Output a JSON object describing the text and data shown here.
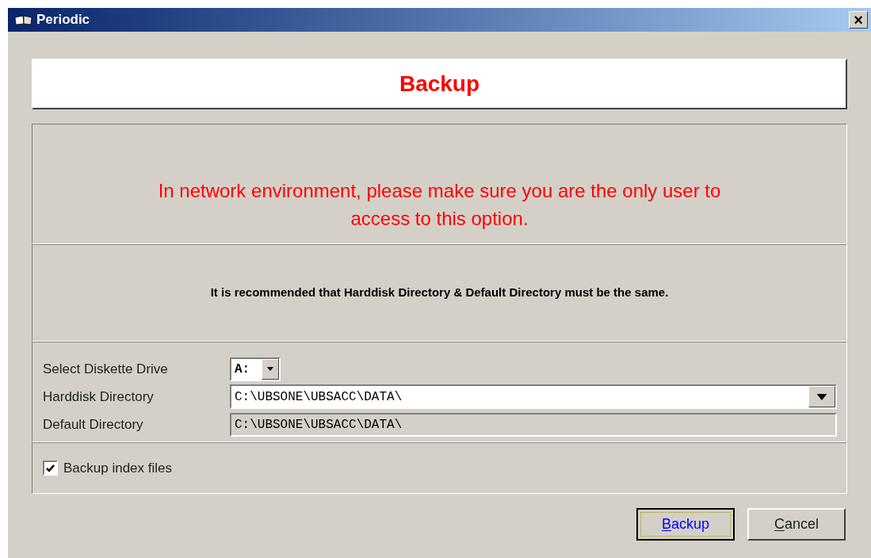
{
  "window": {
    "title": "Periodic",
    "close": "×"
  },
  "heading": "Backup",
  "warning": "In network environment, please make sure you are the only user to access to this option.",
  "note": "It is recommended that Harddisk Directory & Default Directory must be the same.",
  "fields": [
    {
      "kind": "drive",
      "label": "Select Diskette Drive",
      "value": "A:"
    },
    {
      "kind": "combo",
      "label": "Harddisk Directory",
      "value": "C:\\UBSONE\\UBSACC\\DATA\\"
    },
    {
      "kind": "readonly",
      "label": "Default Directory",
      "value": "C:\\UBSONE\\UBSACC\\DATA\\"
    }
  ],
  "backup_index": {
    "label": "Backup index files",
    "checked": true
  },
  "buttons": [
    {
      "label": "Backup",
      "default": true
    },
    {
      "label": "Cancel",
      "default": false
    }
  ]
}
